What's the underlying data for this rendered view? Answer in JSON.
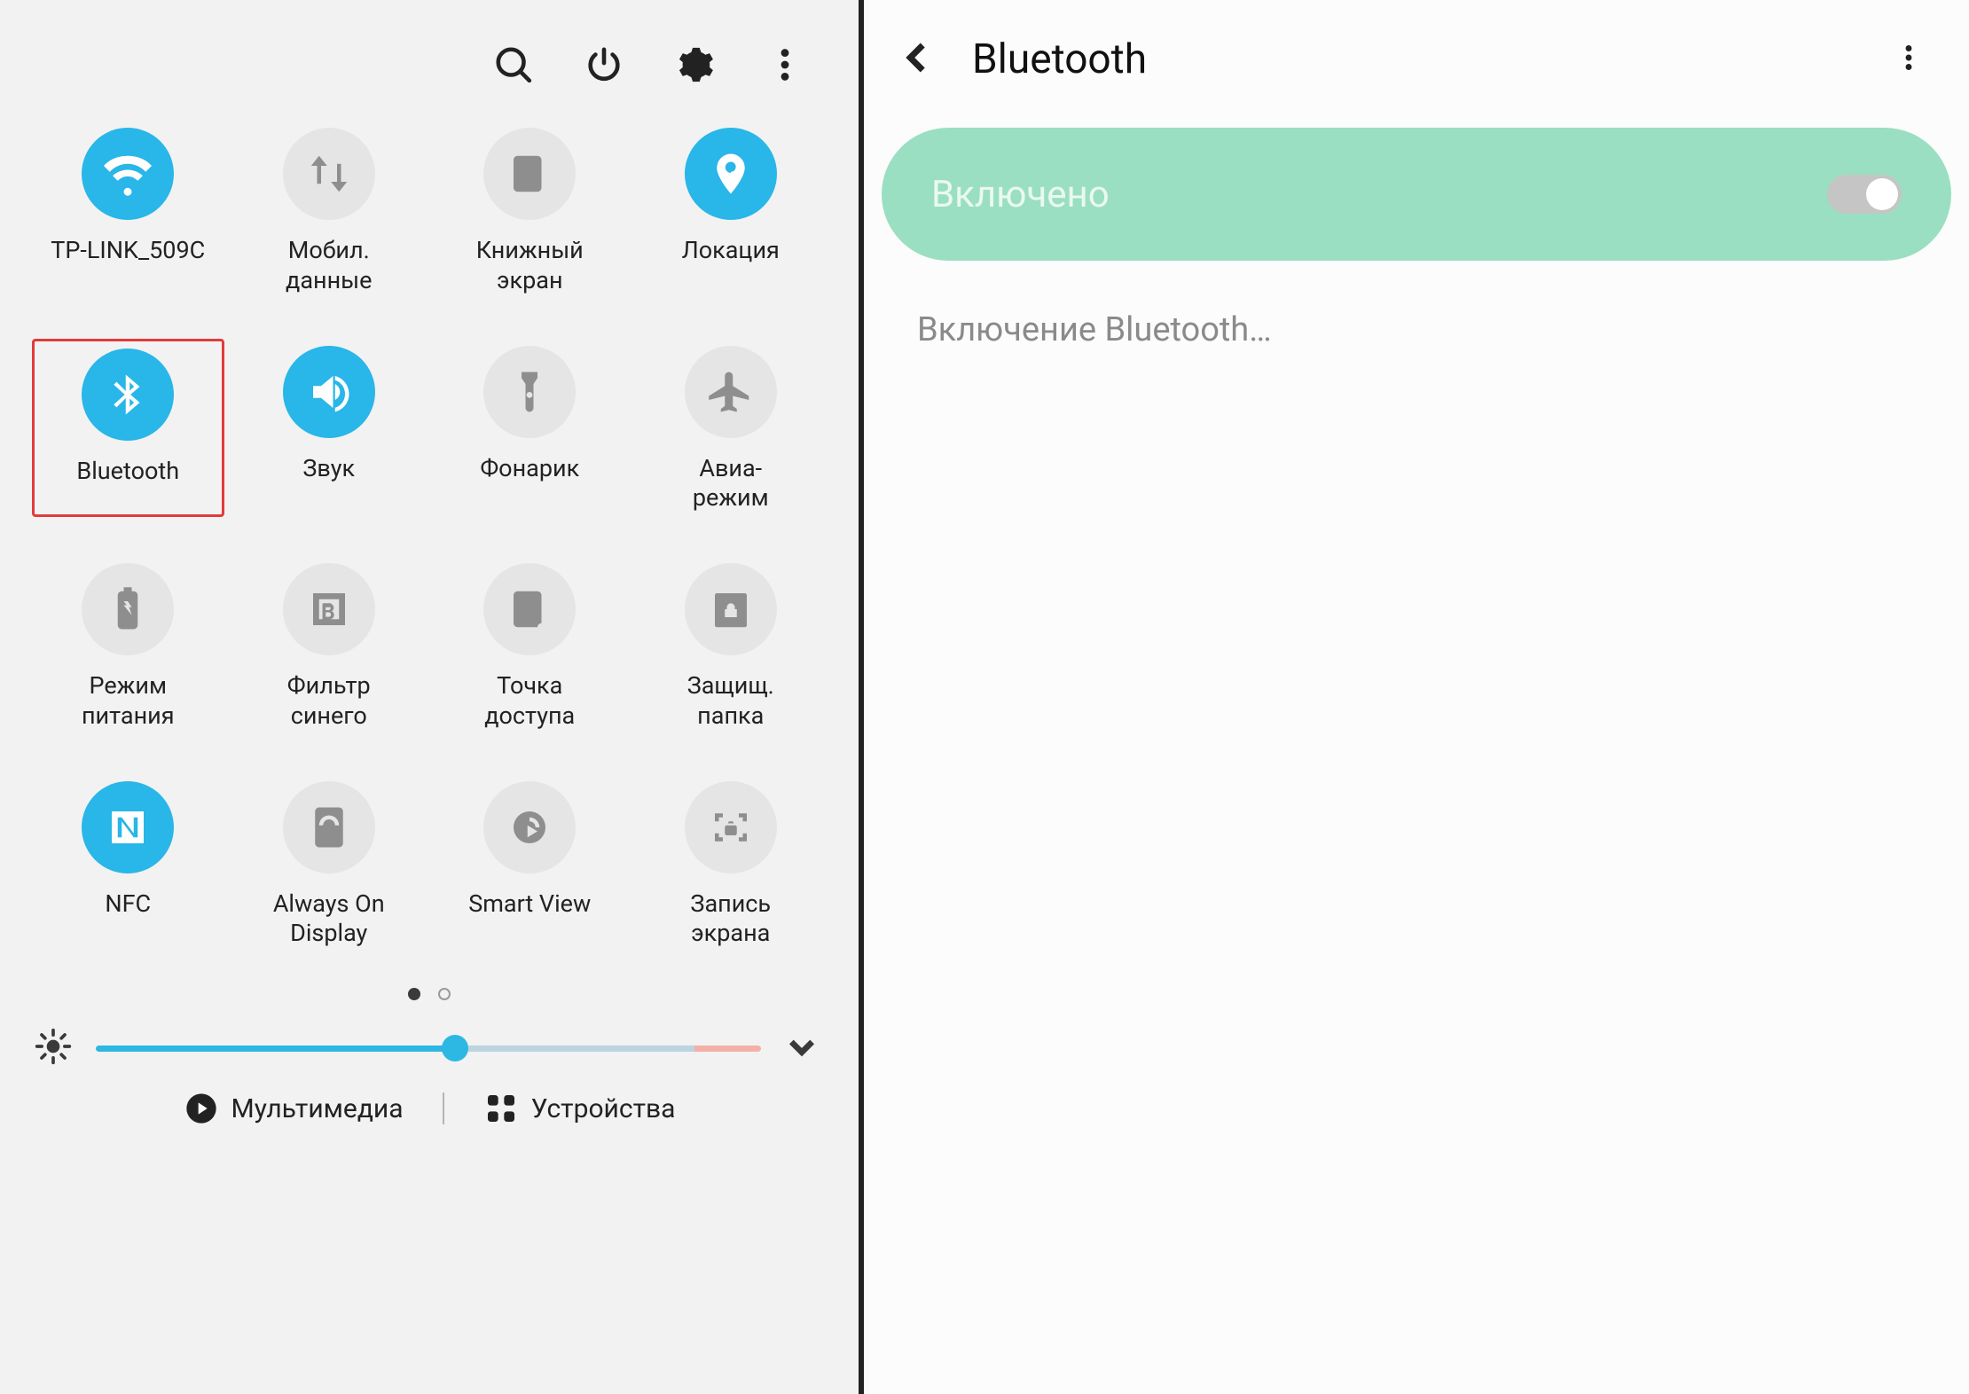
{
  "left": {
    "topbar": [
      "search",
      "power",
      "settings",
      "more"
    ],
    "tiles": [
      {
        "id": "wifi",
        "label": "TP-LINK_509C",
        "active": true,
        "icon": "wifi"
      },
      {
        "id": "mobiledata",
        "label": "Мобил.\nданные",
        "active": false,
        "icon": "swap"
      },
      {
        "id": "bookscreen",
        "label": "Книжный\nэкран",
        "active": false,
        "icon": "book"
      },
      {
        "id": "location",
        "label": "Локация",
        "active": true,
        "icon": "location"
      },
      {
        "id": "bluetooth",
        "label": "Bluetooth",
        "active": true,
        "icon": "bluetooth",
        "highlighted": true
      },
      {
        "id": "sound",
        "label": "Звук",
        "active": true,
        "icon": "sound"
      },
      {
        "id": "flashlight",
        "label": "Фонарик",
        "active": false,
        "icon": "flashlight"
      },
      {
        "id": "airplane",
        "label": "Авиа-\nрежим",
        "active": false,
        "icon": "airplane"
      },
      {
        "id": "powermode",
        "label": "Режим\nпитания",
        "active": false,
        "icon": "battery"
      },
      {
        "id": "bluefilter",
        "label": "Фильтр\nсинего",
        "active": false,
        "icon": "bluelight"
      },
      {
        "id": "hotspot",
        "label": "Точка\nдоступа",
        "active": false,
        "icon": "hotspot"
      },
      {
        "id": "securefolder",
        "label": "Защищ.\nпапка",
        "active": false,
        "icon": "secure"
      },
      {
        "id": "nfc",
        "label": "NFC",
        "active": true,
        "icon": "nfc"
      },
      {
        "id": "aod",
        "label": "Always On\nDisplay",
        "active": false,
        "icon": "aod"
      },
      {
        "id": "smartview",
        "label": "Smart View",
        "active": false,
        "icon": "smartview"
      },
      {
        "id": "screenrec",
        "label": "Запись\nэкрана",
        "active": false,
        "icon": "record"
      }
    ],
    "pages": {
      "count": 2,
      "active": 0
    },
    "brightness_percent": 54,
    "bottom": {
      "media": "Мультимедиа",
      "devices": "Устройства"
    }
  },
  "right": {
    "title": "Bluetooth",
    "pill_label": "Включено",
    "switch_on": true,
    "status_text": "Включение Bluetooth…"
  },
  "colors": {
    "accent": "#29b6e8",
    "pill": "#9adfc1",
    "highlight": "#e33b3b"
  }
}
